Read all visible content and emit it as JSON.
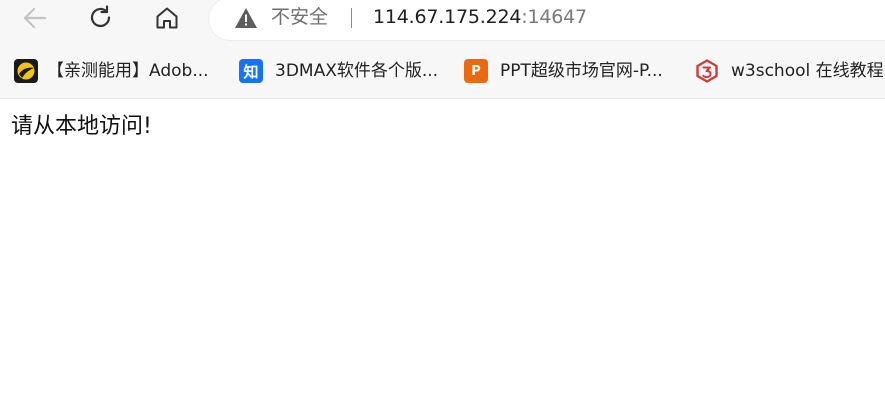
{
  "toolbar": {
    "security_label": "不安全",
    "url_host": "114.67.175.224",
    "url_port": ":14647"
  },
  "bookmarks": [
    {
      "label": "【亲测能用】Adob...",
      "icon": "adobe-bookmark-icon"
    },
    {
      "label": "3DMAX软件各个版...",
      "icon": "zhihu-icon",
      "icon_text": "知"
    },
    {
      "label": "PPT超级市场官网-P...",
      "icon": "ppt-market-icon",
      "icon_text": "P"
    },
    {
      "label": "w3school 在线教程",
      "icon": "w3school-icon"
    }
  ],
  "page": {
    "message": "请从本地访问!"
  },
  "colors": {
    "chrome_bg": "#f7f7f7",
    "zhihu_blue": "#1772f6",
    "ppt_orange": "#ea6a12",
    "w3_red": "#d23b3b"
  }
}
